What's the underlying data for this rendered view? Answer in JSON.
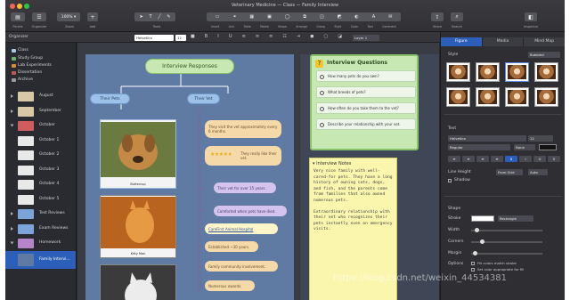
{
  "window": {
    "title": "Veterinary Medicine — Class — Family Interview"
  },
  "toolbar": {
    "panels": "Panels",
    "organizer": "Organizer",
    "zoom_value": "100%",
    "zoom": "Zoom",
    "add": "Add",
    "tools": "Tools",
    "share": "Share",
    "search": "Search",
    "inspector": "Inspector",
    "center_labels": [
      "Insert",
      "Link",
      "Table",
      "Media",
      "Shape",
      "Arrange",
      "Group",
      "Style",
      "Color",
      "Text",
      "Comment"
    ]
  },
  "format_bar": {
    "font": "Helvetica",
    "size": "12",
    "layer": "Layer 1"
  },
  "organizer": {
    "title": "Organizer",
    "items": [
      {
        "label": "Class"
      },
      {
        "label": "Study Group"
      },
      {
        "label": "Lab Experiments"
      },
      {
        "label": "Dissertation"
      },
      {
        "label": "Archive"
      }
    ],
    "pages": [
      {
        "label": "August"
      },
      {
        "label": "September"
      },
      {
        "label": "October"
      },
      {
        "label": "October 1"
      },
      {
        "label": "October 2"
      },
      {
        "label": "October 3"
      },
      {
        "label": "October 4"
      },
      {
        "label": "October 5"
      },
      {
        "label": "Test Reviews"
      },
      {
        "label": "Exam Reviews"
      },
      {
        "label": "Homework"
      },
      {
        "label": "Family Intervi..."
      }
    ]
  },
  "mindmap": {
    "root": "Interview Responses",
    "branch_left": "Their Pets",
    "branch_right": "Their Vet",
    "pets": [
      {
        "caption": "Buttercup"
      },
      {
        "caption": "Kitty Man"
      },
      {
        "caption": ""
      }
    ],
    "vet_nodes": [
      "They visit the vet approximately every 6 months.",
      "They really like their vet.",
      "Their vet for over 15 years.",
      "Comforted when pets have died.",
      "CareFirst Animal Hospital",
      "Established ~30 years.",
      "Family community involvement.",
      "Numerous awards."
    ],
    "rating_stars": 5
  },
  "questions": {
    "title": "Interview Questions",
    "items": [
      "How many pets do you own?",
      "What breeds of pets?",
      "How often do you take them to the vet?",
      "Describe your relationship with your vet."
    ]
  },
  "notes": {
    "title": "Interview Notes",
    "paragraphs": [
      "Very nice family with well-cared-for pets. They have a long history of owning cats, dogs, and fish, and the parents come from families that also owned numerous pets.",
      "Extraordinary relationship with their vet who recognizes their pets instantly even on emergency visits."
    ]
  },
  "inspector": {
    "tabs": [
      "Figure",
      "Media",
      "Mind Map"
    ],
    "style_title": "Style",
    "style_value": "Bubbled",
    "text_title": "Text",
    "font": "Helvetica",
    "font_size": "12",
    "font_style": "Regular",
    "font_none": "None",
    "line_height": "Line Height",
    "line_height_value": "From Grid",
    "line_height_auto": "Auto",
    "shadow": "Shadow",
    "shape_title": "Shape",
    "stroke": "Stroke",
    "stroke_value": "Rectangle",
    "width": "Width",
    "corners": "Corners",
    "margin": "Margin",
    "options": "Options",
    "opt1": "Fill colors match stroke",
    "opt2": "Set color appropriate for fill",
    "accent": "#2c5fb9"
  },
  "watermark": "https://blog.csdn.net/weixin_44534381"
}
